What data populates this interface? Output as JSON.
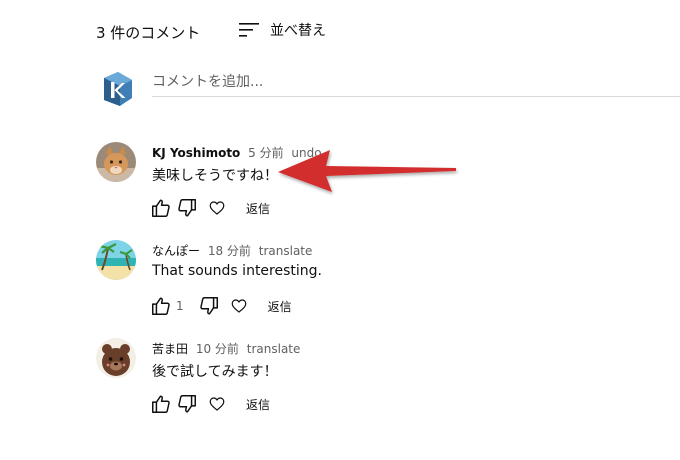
{
  "header": {
    "count_label": "3 件のコメント",
    "sort_label": "並べ替え",
    "sort_icon": "sort-icon"
  },
  "add_comment": {
    "placeholder": "コメントを追加...",
    "avatar_icon": "k-logo-icon"
  },
  "comments": [
    {
      "author": "KJ Yoshimoto",
      "time": "5 分前",
      "link": "undo",
      "text": "美味しそうですね！",
      "likes": "",
      "reply": "返信",
      "avatar": "cat-avatar"
    },
    {
      "author": "なんぽー",
      "time": "18 分前",
      "link": "translate",
      "text": "That sounds interesting.",
      "likes": "1",
      "reply": "返信",
      "avatar": "beach-avatar"
    },
    {
      "author": "苦ま田",
      "time": "10 分前",
      "link": "translate",
      "text": "後で試してみます！",
      "likes": "",
      "reply": "返信",
      "avatar": "bear-avatar"
    }
  ],
  "annotation": {
    "arrow_color": "#d32f2f"
  }
}
